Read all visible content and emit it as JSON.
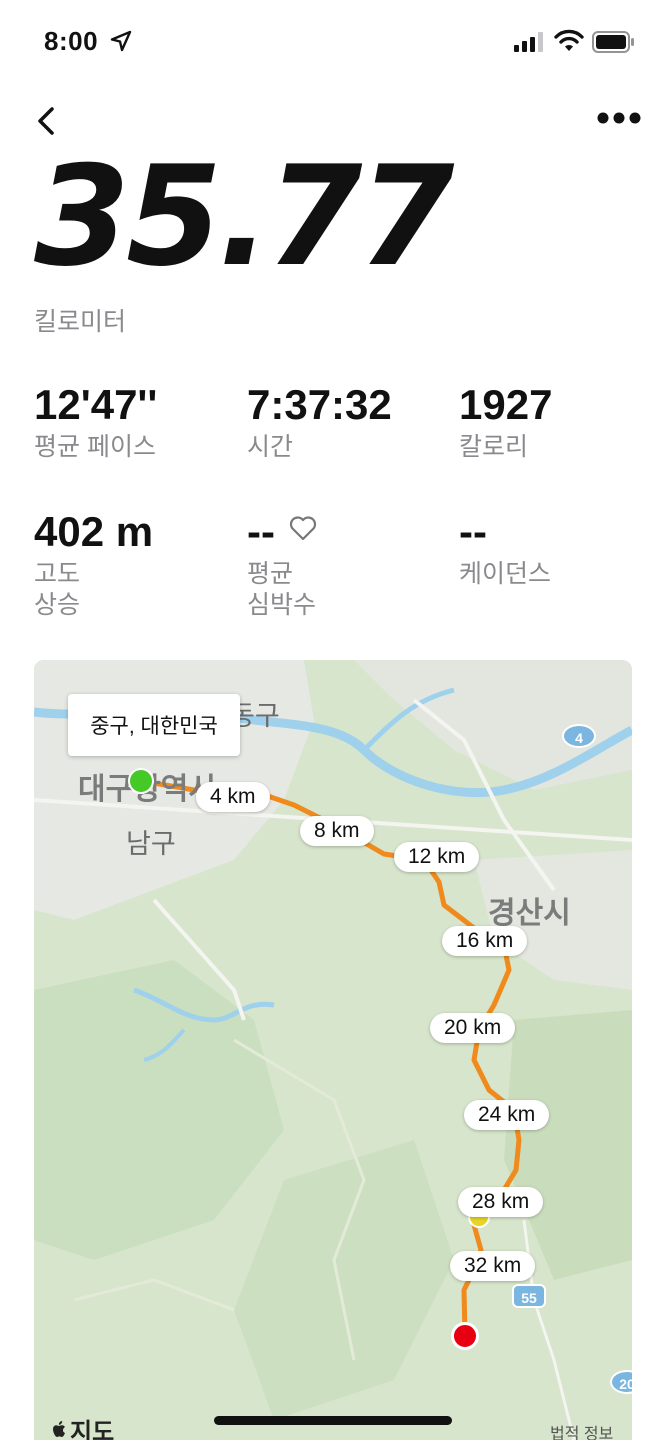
{
  "status_bar": {
    "time": "8:00"
  },
  "summary": {
    "distance": "35.77",
    "distance_unit": "킬로미터"
  },
  "stats": {
    "pace": {
      "value": "12'47''",
      "label": "평균 페이스"
    },
    "time": {
      "value": "7:37:32",
      "label": "시간"
    },
    "calories": {
      "value": "1927",
      "label": "칼로리"
    },
    "elevation": {
      "value": "402 m",
      "label_line1": "고도",
      "label_line2": "상승"
    },
    "heart_rate": {
      "value": "--",
      "label_line1": "평균",
      "label_line2": "심박수"
    },
    "cadence": {
      "value": "--",
      "label": "케이던스"
    }
  },
  "map": {
    "callout": "중구, 대한민국",
    "places": {
      "daegu": "대구광역시",
      "namgu": "남구",
      "donggu": "동구",
      "gyeongsan": "경산시"
    },
    "km_markers": [
      "4 km",
      "8 km",
      "12 km",
      "16 km",
      "20 km",
      "24 km",
      "28 km",
      "32 km"
    ],
    "route_shields": [
      "4",
      "55",
      "20"
    ],
    "maps_label": "지도",
    "legal": "법적 정보",
    "route_color": "#f08a1c",
    "start_color": "#45c927",
    "end_color": "#e60012"
  }
}
